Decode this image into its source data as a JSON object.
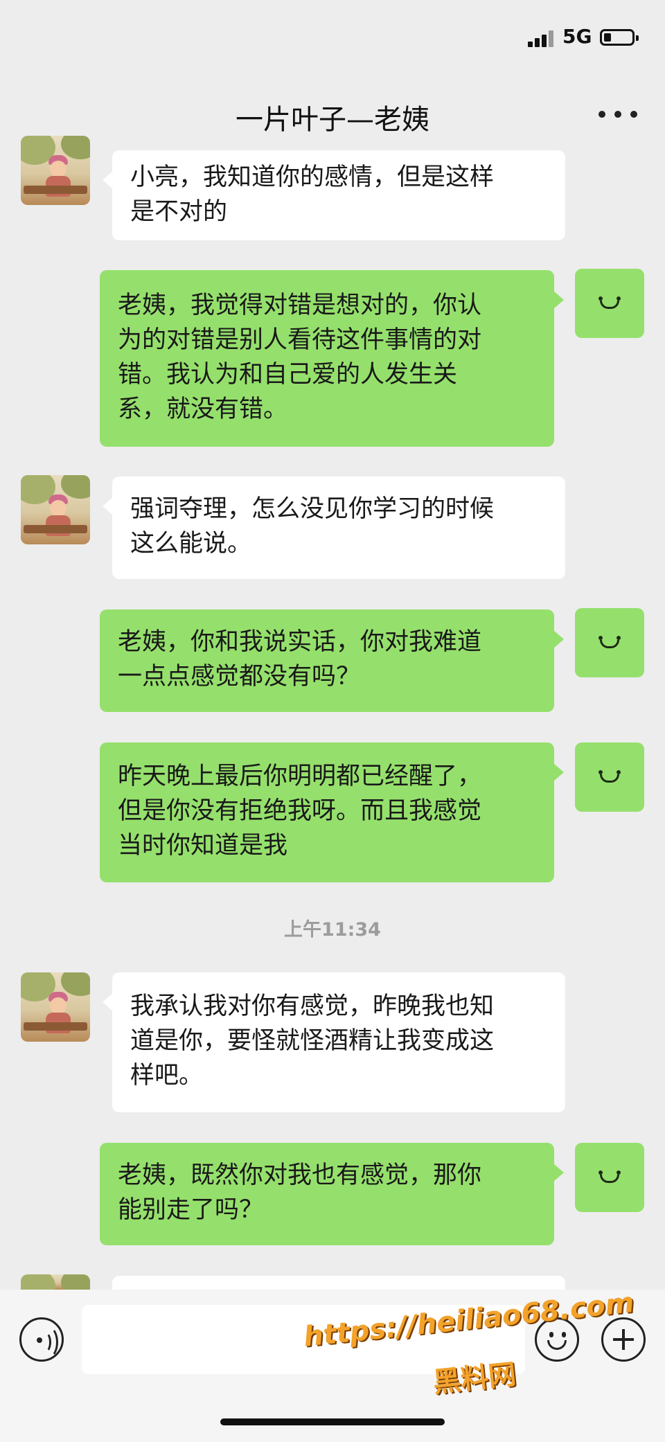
{
  "status_bar": {
    "network": "5G"
  },
  "header": {
    "title": "一片叶子—老姨"
  },
  "messages": [
    {
      "sender": "other",
      "text": "小亮，我知道你的感情，但是这样\n是不对的"
    },
    {
      "sender": "self",
      "text": "老姨，我觉得对错是想对的，你认\n为的对错是别人看待这件事情的对\n错。我认为和自己爱的人发生关\n系，就没有错。"
    },
    {
      "sender": "other",
      "text": "强词夺理，怎么没见你学习的时候\n这么能说。"
    },
    {
      "sender": "self",
      "text": "老姨，你和我说实话，你对我难道\n一点点感觉都没有吗？"
    },
    {
      "sender": "self",
      "text": "昨天晚上最后你明明都已经醒了，\n但是你没有拒绝我呀。而且我感觉\n当时你知道是我"
    },
    {
      "sender": "other",
      "text": "我承认我对你有感觉，昨晚我也知\n道是你，要怪就怪酒精让我变成这\n样吧。"
    },
    {
      "sender": "self",
      "text": "老姨，既然你对我也有感觉，那你\n能别走了吗？"
    }
  ],
  "timestamp": "上午11:34",
  "watermark": {
    "url": "https://heiliao68.com",
    "name": "黑料网"
  },
  "colors": {
    "self_bubble": "#95e06c",
    "other_bubble": "#ffffff",
    "background": "#ededed"
  }
}
